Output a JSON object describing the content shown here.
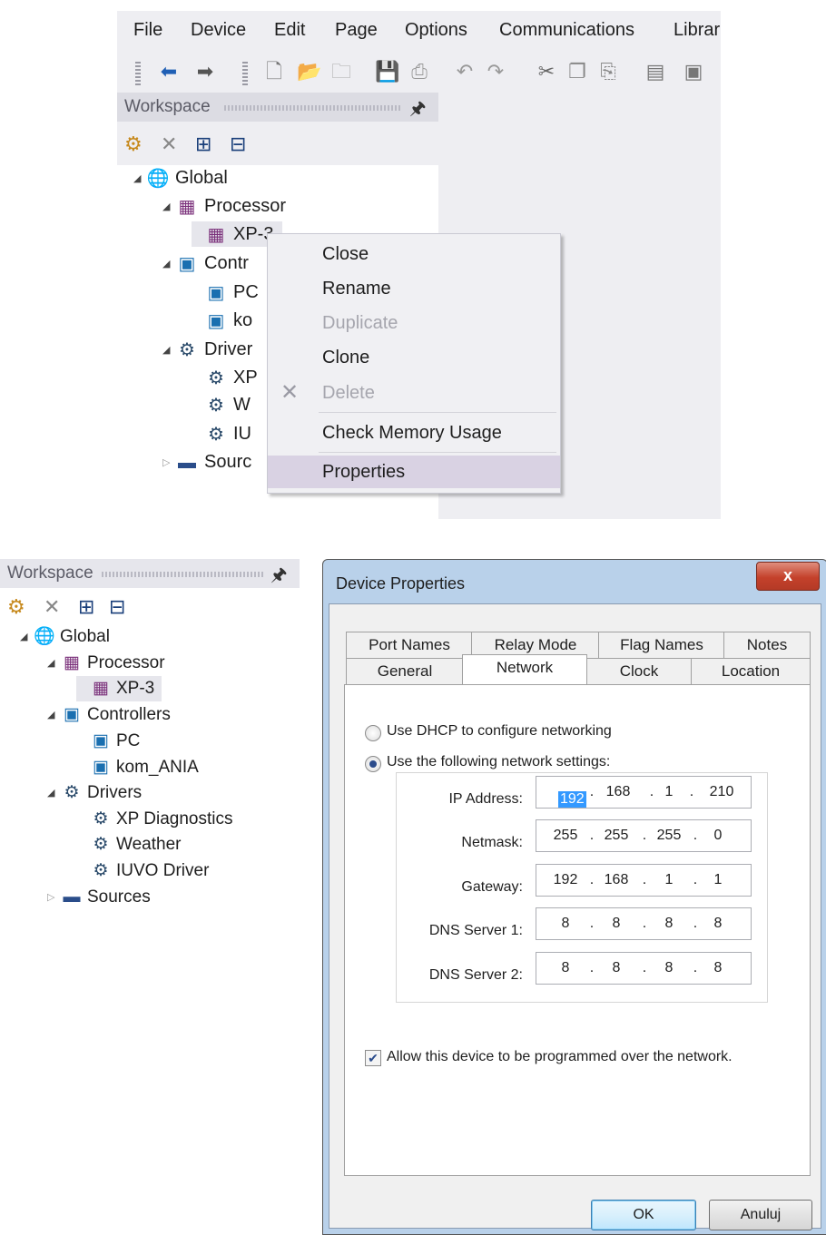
{
  "top": {
    "menu": [
      "File",
      "Device",
      "Edit",
      "Page",
      "Options",
      "Communications",
      "Librar"
    ],
    "toolbar_icons": [
      "back-icon",
      "forward-icon",
      "new-icon",
      "open-icon",
      "close-doc-icon",
      "save-icon",
      "print-icon",
      "undo-icon",
      "redo-icon",
      "cut-icon",
      "copy-icon",
      "paste-icon",
      "view-icon",
      "image-icon"
    ],
    "workspace_title": "Workspace",
    "tree": [
      {
        "label": "Global",
        "icon": "globe-icon"
      },
      {
        "label": "Processor",
        "icon": "processor-icon"
      },
      {
        "label": "XP-3",
        "icon": "processor-icon"
      },
      {
        "label": "Contr",
        "icon": "controller-icon"
      },
      {
        "label": "PC",
        "icon": "controller-icon"
      },
      {
        "label": "ko",
        "icon": "controller-icon"
      },
      {
        "label": "Driver",
        "icon": "gear-icon"
      },
      {
        "label": "XP",
        "icon": "gear-icon"
      },
      {
        "label": "W",
        "icon": "gear-icon"
      },
      {
        "label": "IU",
        "icon": "gear-icon"
      },
      {
        "label": "Sourc",
        "icon": "source-icon"
      }
    ],
    "context_menu": [
      {
        "label": "Close",
        "enabled": true
      },
      {
        "label": "Rename",
        "enabled": true
      },
      {
        "label": "Duplicate",
        "enabled": false
      },
      {
        "label": "Clone",
        "enabled": true
      },
      {
        "label": "Delete",
        "enabled": false
      },
      {
        "label": "Check Memory Usage",
        "enabled": true
      },
      {
        "label": "Properties",
        "enabled": true,
        "highlighted": true
      }
    ]
  },
  "bottom": {
    "workspace_title": "Workspace",
    "tree": [
      {
        "label": "Global",
        "icon": "globe-icon"
      },
      {
        "label": "Processor",
        "icon": "processor-icon"
      },
      {
        "label": "XP-3",
        "icon": "processor-icon"
      },
      {
        "label": "Controllers",
        "icon": "controller-icon"
      },
      {
        "label": "PC",
        "icon": "controller-icon"
      },
      {
        "label": "kom_ANIA",
        "icon": "controller-icon"
      },
      {
        "label": "Drivers",
        "icon": "gear-icon"
      },
      {
        "label": "XP Diagnostics",
        "icon": "gear-icon"
      },
      {
        "label": "Weather",
        "icon": "gear-icon"
      },
      {
        "label": "IUVO Driver",
        "icon": "gear-icon"
      },
      {
        "label": "Sources",
        "icon": "source-icon"
      }
    ],
    "dialog": {
      "title": "Device Properties",
      "close": "x",
      "tabs_row1": [
        "Port Names",
        "Relay Mode",
        "Flag Names",
        "Notes"
      ],
      "tabs_row2": [
        "General",
        "Network",
        "Clock",
        "Location"
      ],
      "active_tab": "Network",
      "dhcp_label": "Use DHCP to configure networking",
      "static_label": "Use the following network settings:",
      "dhcp_selected": false,
      "fields": [
        {
          "label": "IP Address:",
          "octets": [
            "192",
            "168",
            "1",
            "210"
          ]
        },
        {
          "label": "Netmask:",
          "octets": [
            "255",
            "255",
            "255",
            "0"
          ]
        },
        {
          "label": "Gateway:",
          "octets": [
            "192",
            "168",
            "1",
            "1"
          ]
        },
        {
          "label": "DNS Server 1:",
          "octets": [
            "8",
            "8",
            "8",
            "8"
          ]
        },
        {
          "label": "DNS Server 2:",
          "octets": [
            "8",
            "8",
            "8",
            "8"
          ]
        }
      ],
      "allow_label": "Allow this device to be programmed over the network.",
      "allow_checked": true,
      "ok": "OK",
      "cancel": "Anuluj"
    }
  }
}
